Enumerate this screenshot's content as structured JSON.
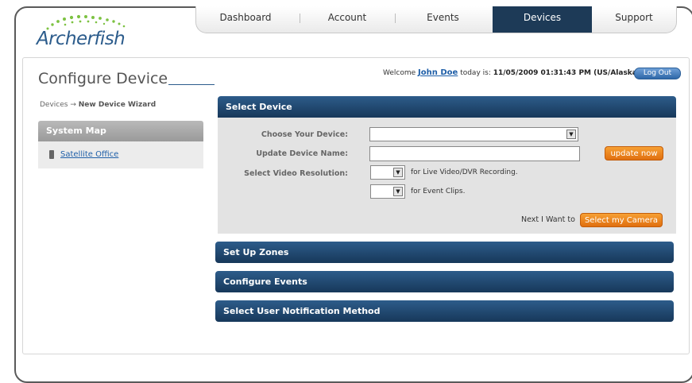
{
  "logo": {
    "text": "Archerfish"
  },
  "nav": {
    "tabs": [
      {
        "label": "Dashboard"
      },
      {
        "label": "Account"
      },
      {
        "label": "Events"
      },
      {
        "label": "Devices"
      },
      {
        "label": "Support"
      }
    ],
    "active": "Devices"
  },
  "header": {
    "page_title": "Configure Device",
    "welcome_prefix": "Welcome",
    "user_name": "John Doe",
    "today_text": "today is:",
    "datetime": "11/05/2009 01:31:43 PM (US/Alaska)",
    "logout_label": "Log Out"
  },
  "breadcrumb": {
    "root": "Devices",
    "separator": "→",
    "current": "New Device Wizard"
  },
  "sidebar": {
    "title": "System Map",
    "items": [
      {
        "label": "Satellite Office",
        "icon": "camera-icon"
      }
    ]
  },
  "select_device": {
    "title": "Select Device",
    "device_label": "Choose Your Device:",
    "device_value": "",
    "name_label": "Update Device Name:",
    "name_value": "",
    "update_button": "update now",
    "resolution_label": "Select Video Resolution:",
    "live_hint": "for Live Video/DVR Recording.",
    "clips_hint": "for Event Clips.",
    "next_text": "Next I Want to",
    "next_button": "Select my Camera"
  },
  "sections": [
    {
      "title": "Set Up Zones"
    },
    {
      "title": "Configure Events"
    },
    {
      "title": "Select User Notification Method"
    }
  ],
  "colors": {
    "header_blue": "#1d3a57",
    "accent_orange": "#f08a20",
    "link_blue": "#1f5fa8"
  }
}
